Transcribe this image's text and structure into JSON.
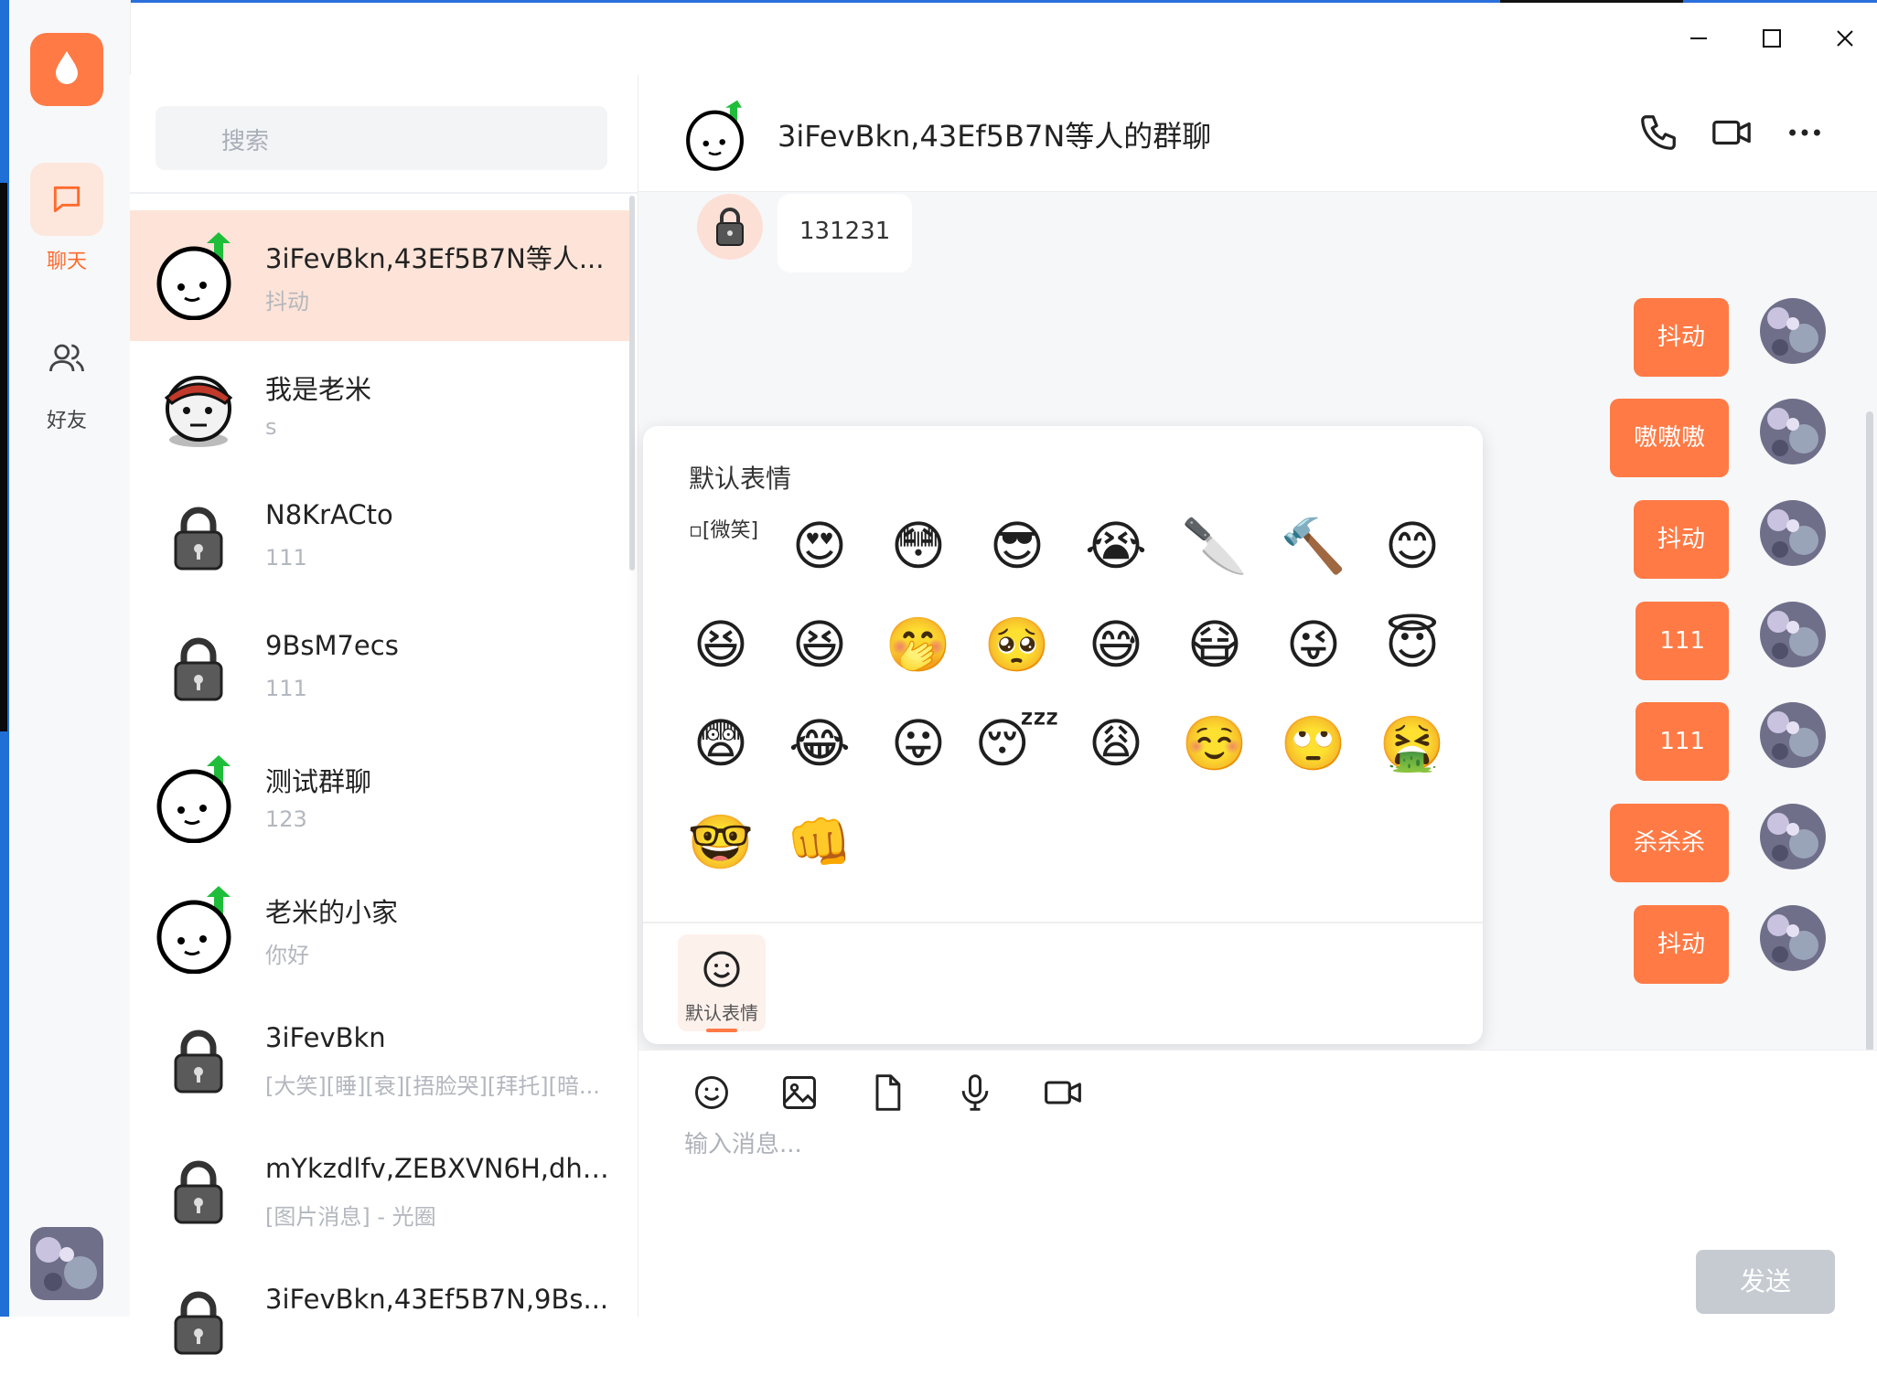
{
  "window": {
    "minimize_label": "—",
    "maximize_label": "☐",
    "close_label": "✕"
  },
  "rail": {
    "chat_label": "聊天",
    "friends_label": "好友"
  },
  "search": {
    "placeholder": "搜索"
  },
  "conversations": [
    {
      "name": "3iFevBkn,43Ef5B7N等人...",
      "preview": "抖动",
      "avatar": "egg-avatar"
    },
    {
      "name": "我是老米",
      "preview": "s",
      "avatar": "pirate-avatar"
    },
    {
      "name": "N8KrACto",
      "preview": "111",
      "avatar": "lock-avatar"
    },
    {
      "name": "9BsM7ecs",
      "preview": "111",
      "avatar": "lock-avatar"
    },
    {
      "name": "测试群聊",
      "preview": "123",
      "avatar": "egg-avatar"
    },
    {
      "name": "老米的小家",
      "preview": "你好",
      "avatar": "egg-avatar"
    },
    {
      "name": "3iFevBkn",
      "preview": "[大笑][睡][衰][捂脸哭][拜托][暗...",
      "avatar": "lock-avatar"
    },
    {
      "name": "mYkzdlfv,ZEBXVN6H,dhi...",
      "preview": "[图片消息] - 光圈",
      "avatar": "lock-avatar"
    },
    {
      "name": "3iFevBkn,43Ef5B7N,9Bs...",
      "preview": "",
      "avatar": "lock-avatar"
    }
  ],
  "chat": {
    "title": "3iFevBkn,43Ef5B7N等人的群聊",
    "incoming": [
      {
        "text": "131231"
      }
    ],
    "outgoing": [
      {
        "text": "抖动"
      },
      {
        "text": "嗷嗷嗷"
      },
      {
        "text": "抖动"
      },
      {
        "text": "111"
      },
      {
        "text": "111"
      },
      {
        "text": "杀杀杀"
      },
      {
        "text": "抖动"
      }
    ]
  },
  "emoji_panel": {
    "title": "默认表情",
    "broken_image_alt": "[微笑]",
    "emojis": [
      "😍",
      "😳",
      "😎",
      "😭",
      "🔪",
      "🔨",
      "😊",
      "😆",
      "😆",
      "🤭",
      "🥺",
      "😅",
      "😷",
      "😜",
      "😇",
      "😨",
      "😂",
      "😛",
      "😴",
      "😩",
      "☺️",
      "🙄",
      "🤮",
      "🤓",
      "👊"
    ],
    "tab_label": "默认表情"
  },
  "composer": {
    "placeholder": "输入消息...",
    "send_label": "发送"
  },
  "colors": {
    "accent": "#ff7a45",
    "active_bg": "#fee4d8",
    "send_disabled": "#c6cbd2"
  }
}
